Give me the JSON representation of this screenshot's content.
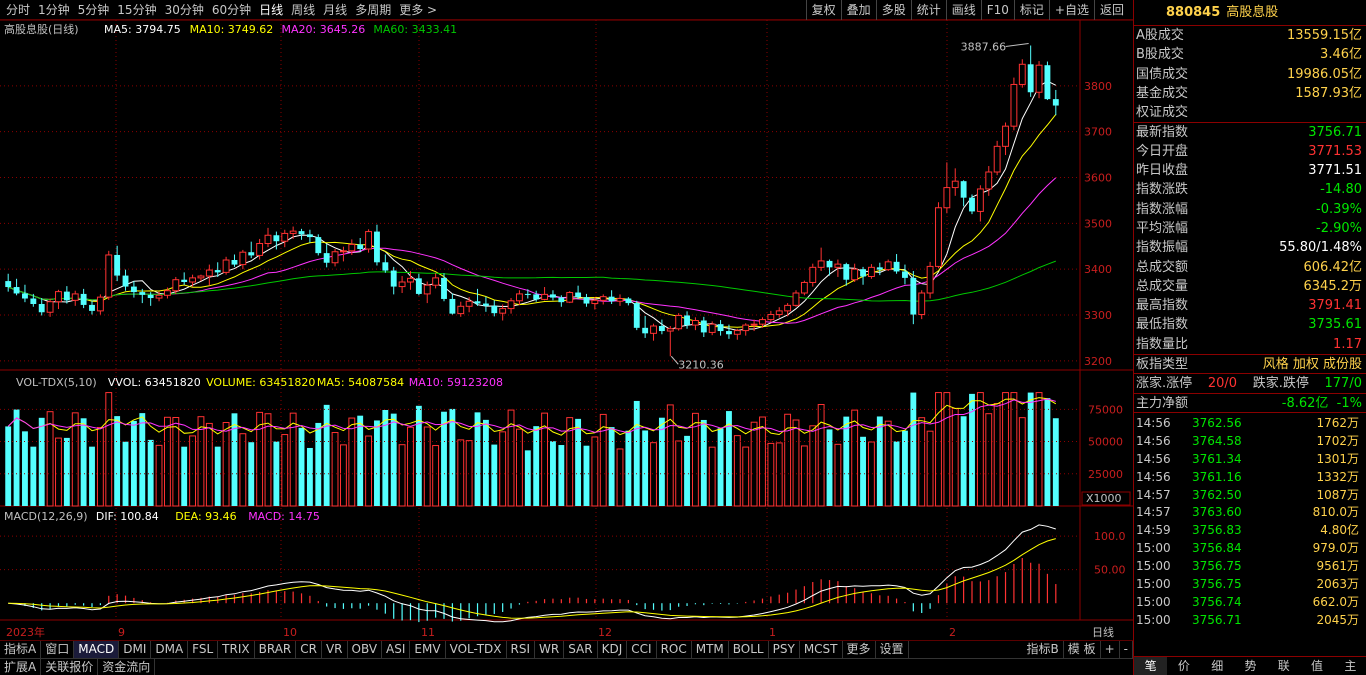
{
  "toolbar": {
    "periods": [
      "分时",
      "1分钟",
      "5分钟",
      "15分钟",
      "30分钟",
      "60分钟",
      "日线",
      "周线",
      "月线",
      "多周期",
      "更多 >"
    ],
    "active_period": "日线",
    "actions": [
      "复权",
      "叠加",
      "多股",
      "统计",
      "画线",
      "F10",
      "标记",
      "+自选",
      "返回"
    ]
  },
  "chart_data": {
    "type": "candlestick",
    "title": "高股息股(日线)",
    "ma_legend": [
      {
        "name": "MA5: 3794.75",
        "color": "#ffffff"
      },
      {
        "name": "MA10: 3749.62",
        "color": "#ffff00"
      },
      {
        "name": "MA20: 3645.26",
        "color": "#ff33ff"
      },
      {
        "name": "MA60: 3433.41",
        "color": "#00c800"
      }
    ],
    "price_axis": {
      "ticks": [
        3200,
        3300,
        3400,
        3500,
        3600,
        3700,
        3800
      ],
      "ylim": [
        3180,
        3900
      ]
    },
    "annotations": [
      {
        "text": "3887.66"
      },
      {
        "text": "3210.36"
      }
    ],
    "x_labels": [
      "2023年",
      "9",
      "10",
      "11",
      "12",
      "1",
      "2"
    ],
    "ohlc": [
      [
        3374,
        3390,
        3351,
        3361
      ],
      [
        3361,
        3379,
        3343,
        3347
      ],
      [
        3347,
        3366,
        3328,
        3336
      ],
      [
        3336,
        3346,
        3318,
        3324
      ],
      [
        3324,
        3337,
        3299,
        3306
      ],
      [
        3306,
        3336,
        3296,
        3329
      ],
      [
        3329,
        3355,
        3313,
        3351
      ],
      [
        3351,
        3363,
        3325,
        3332
      ],
      [
        3332,
        3353,
        3320,
        3346
      ],
      [
        3346,
        3357,
        3315,
        3322
      ],
      [
        3322,
        3331,
        3301,
        3309
      ],
      [
        3309,
        3345,
        3301,
        3339
      ],
      [
        3339,
        3440,
        3333,
        3431
      ],
      [
        3431,
        3451,
        3374,
        3386
      ],
      [
        3386,
        3399,
        3353,
        3362
      ],
      [
        3362,
        3374,
        3338,
        3350
      ],
      [
        3350,
        3357,
        3326,
        3344
      ],
      [
        3344,
        3350,
        3320,
        3337
      ],
      [
        3337,
        3351,
        3330,
        3343
      ],
      [
        3343,
        3360,
        3336,
        3353
      ],
      [
        3353,
        3383,
        3346,
        3377
      ],
      [
        3377,
        3393,
        3366,
        3372
      ],
      [
        3372,
        3388,
        3362,
        3381
      ],
      [
        3381,
        3388,
        3374,
        3385
      ],
      [
        3385,
        3410,
        3364,
        3398
      ],
      [
        3398,
        3415,
        3383,
        3393
      ],
      [
        3393,
        3427,
        3388,
        3420
      ],
      [
        3420,
        3432,
        3405,
        3410
      ],
      [
        3410,
        3442,
        3400,
        3437
      ],
      [
        3437,
        3460,
        3424,
        3430
      ],
      [
        3430,
        3466,
        3421,
        3456
      ],
      [
        3456,
        3490,
        3448,
        3474
      ],
      [
        3474,
        3482,
        3443,
        3461
      ],
      [
        3461,
        3486,
        3448,
        3478
      ],
      [
        3478,
        3493,
        3466,
        3483
      ],
      [
        3483,
        3488,
        3464,
        3476
      ],
      [
        3476,
        3486,
        3458,
        3470
      ],
      [
        3470,
        3476,
        3430,
        3435
      ],
      [
        3435,
        3455,
        3404,
        3414
      ],
      [
        3414,
        3444,
        3406,
        3438
      ],
      [
        3438,
        3449,
        3417,
        3440
      ],
      [
        3440,
        3465,
        3431,
        3454
      ],
      [
        3454,
        3468,
        3438,
        3444
      ],
      [
        3444,
        3487,
        3436,
        3482
      ],
      [
        3482,
        3497,
        3408,
        3415
      ],
      [
        3415,
        3432,
        3392,
        3397
      ],
      [
        3397,
        3405,
        3345,
        3362
      ],
      [
        3362,
        3385,
        3348,
        3372
      ],
      [
        3372,
        3396,
        3355,
        3380
      ],
      [
        3380,
        3390,
        3343,
        3346
      ],
      [
        3346,
        3373,
        3326,
        3365
      ],
      [
        3365,
        3391,
        3358,
        3381
      ],
      [
        3381,
        3391,
        3330,
        3335
      ],
      [
        3335,
        3347,
        3301,
        3303
      ],
      [
        3303,
        3329,
        3296,
        3319
      ],
      [
        3319,
        3339,
        3306,
        3330
      ],
      [
        3330,
        3357,
        3320,
        3325
      ],
      [
        3325,
        3340,
        3307,
        3320
      ],
      [
        3320,
        3332,
        3297,
        3304
      ],
      [
        3304,
        3323,
        3288,
        3314
      ],
      [
        3314,
        3337,
        3303,
        3331
      ],
      [
        3331,
        3354,
        3322,
        3346
      ],
      [
        3346,
        3356,
        3336,
        3345
      ],
      [
        3345,
        3353,
        3329,
        3334
      ],
      [
        3334,
        3361,
        3332,
        3345
      ],
      [
        3345,
        3354,
        3332,
        3338
      ],
      [
        3338,
        3343,
        3318,
        3328
      ],
      [
        3328,
        3352,
        3326,
        3349
      ],
      [
        3349,
        3364,
        3335,
        3339
      ],
      [
        3339,
        3346,
        3318,
        3325
      ],
      [
        3325,
        3339,
        3312,
        3332
      ],
      [
        3332,
        3345,
        3323,
        3340
      ],
      [
        3340,
        3354,
        3324,
        3330
      ],
      [
        3330,
        3345,
        3320,
        3336
      ],
      [
        3336,
        3339,
        3321,
        3326
      ],
      [
        3326,
        3331,
        3267,
        3272
      ],
      [
        3272,
        3298,
        3250,
        3260
      ],
      [
        3260,
        3281,
        3244,
        3276
      ],
      [
        3276,
        3290,
        3258,
        3265
      ],
      [
        3265,
        3276,
        3210,
        3270
      ],
      [
        3270,
        3304,
        3266,
        3299
      ],
      [
        3299,
        3308,
        3270,
        3278
      ],
      [
        3278,
        3295,
        3267,
        3288
      ],
      [
        3288,
        3296,
        3252,
        3262
      ],
      [
        3262,
        3286,
        3256,
        3280
      ],
      [
        3280,
        3289,
        3255,
        3265
      ],
      [
        3265,
        3279,
        3248,
        3258
      ],
      [
        3258,
        3270,
        3246,
        3266
      ],
      [
        3266,
        3282,
        3255,
        3278
      ],
      [
        3278,
        3290,
        3265,
        3280
      ],
      [
        3280,
        3295,
        3272,
        3290
      ],
      [
        3290,
        3309,
        3284,
        3301
      ],
      [
        3301,
        3317,
        3294,
        3309
      ],
      [
        3309,
        3326,
        3297,
        3321
      ],
      [
        3321,
        3354,
        3318,
        3348
      ],
      [
        3348,
        3375,
        3343,
        3371
      ],
      [
        3371,
        3412,
        3362,
        3404
      ],
      [
        3404,
        3447,
        3396,
        3418
      ],
      [
        3418,
        3421,
        3386,
        3404
      ],
      [
        3404,
        3421,
        3383,
        3411
      ],
      [
        3411,
        3414,
        3364,
        3377
      ],
      [
        3377,
        3412,
        3372,
        3400
      ],
      [
        3400,
        3405,
        3366,
        3384
      ],
      [
        3384,
        3411,
        3379,
        3404
      ],
      [
        3404,
        3414,
        3387,
        3399
      ],
      [
        3399,
        3421,
        3396,
        3416
      ],
      [
        3416,
        3433,
        3390,
        3395
      ],
      [
        3395,
        3410,
        3367,
        3381
      ],
      [
        3381,
        3396,
        3280,
        3301
      ],
      [
        3301,
        3354,
        3291,
        3348
      ],
      [
        3348,
        3416,
        3336,
        3406
      ],
      [
        3406,
        3546,
        3402,
        3534
      ],
      [
        3534,
        3633,
        3522,
        3578
      ],
      [
        3578,
        3620,
        3560,
        3592
      ],
      [
        3592,
        3594,
        3537,
        3556
      ],
      [
        3556,
        3563,
        3520,
        3526
      ],
      [
        3526,
        3583,
        3504,
        3575
      ],
      [
        3575,
        3625,
        3560,
        3612
      ],
      [
        3612,
        3680,
        3605,
        3668
      ],
      [
        3668,
        3720,
        3649,
        3712
      ],
      [
        3712,
        3818,
        3703,
        3803
      ],
      [
        3803,
        3858,
        3796,
        3847
      ],
      [
        3847,
        3888,
        3776,
        3786
      ],
      [
        3786,
        3854,
        3773,
        3845
      ],
      [
        3845,
        3853,
        3769,
        3771
      ],
      [
        3771,
        3791,
        3736,
        3757
      ]
    ],
    "volume_legend": [
      {
        "name": "VOL-TDX(5,10)",
        "color": "#c0c0c0"
      },
      {
        "name": "VVOL: 63451820",
        "color": "#ffffff"
      },
      {
        "name": "VOLUME: 63451820",
        "color": "#ffff00"
      },
      {
        "name": "MA5: 54087584",
        "color": "#ffff00"
      },
      {
        "name": "MA10: 59123208",
        "color": "#ff33ff"
      }
    ],
    "volume_axis": {
      "ticks": [
        "75000",
        "50000",
        "25000"
      ],
      "unit": "X1000"
    },
    "macd_legend": [
      {
        "name": "MACD(12,26,9)",
        "color": "#c0c0c0"
      },
      {
        "name": "DIF: 100.84",
        "color": "#ffffff"
      },
      {
        "name": "DEA: 93.46",
        "color": "#ffff00"
      },
      {
        "name": "MACD: 14.75",
        "color": "#ff33ff"
      }
    ],
    "macd_axis": {
      "ticks": [
        "100.0",
        "50.00"
      ]
    },
    "period_label": "日线"
  },
  "indicator_tabs": [
    "指标A",
    "窗口",
    "MACD",
    "DMI",
    "DMA",
    "FSL",
    "TRIX",
    "BRAR",
    "CR",
    "VR",
    "OBV",
    "ASI",
    "EMV",
    "VOL-TDX",
    "RSI",
    "WR",
    "SAR",
    "KDJ",
    "CCI",
    "ROC",
    "MTM",
    "BOLL",
    "PSY",
    "MCST",
    "更多",
    "设置"
  ],
  "indicator_tabs_right": [
    "指标B",
    "模 板",
    "+",
    "-"
  ],
  "bottom_tabs": [
    "扩展A",
    "关联报价",
    "资金流向"
  ],
  "side": {
    "code": "880845",
    "name": "高股息股",
    "stats": [
      {
        "k": "A股成交",
        "v": "13559.15亿",
        "c": "yel"
      },
      {
        "k": "B股成交",
        "v": "3.46亿",
        "c": "yel"
      },
      {
        "k": "国债成交",
        "v": "19986.05亿",
        "c": "yel"
      },
      {
        "k": "基金成交",
        "v": "1587.93亿",
        "c": "yel"
      },
      {
        "k": "权证成交",
        "v": "",
        "c": "yel"
      },
      {
        "k": "最新指数",
        "v": "3756.71",
        "c": "green"
      },
      {
        "k": "今日开盘",
        "v": "3771.53",
        "c": "red"
      },
      {
        "k": "昨日收盘",
        "v": "3771.51",
        "c": ""
      },
      {
        "k": "指数涨跌",
        "v": "-14.80",
        "c": "green"
      },
      {
        "k": "指数涨幅",
        "v": "-0.39%",
        "c": "green"
      },
      {
        "k": "平均涨幅",
        "v": "-2.90%",
        "c": "green"
      },
      {
        "k": "指数振幅",
        "v": "55.80/1.48%",
        "c": ""
      },
      {
        "k": "总成交额",
        "v": "606.42亿",
        "c": "yel"
      },
      {
        "k": "总成交量",
        "v": "6345.2万",
        "c": "yel"
      },
      {
        "k": "最高指数",
        "v": "3791.41",
        "c": "red"
      },
      {
        "k": "最低指数",
        "v": "3735.61",
        "c": "green"
      },
      {
        "k": "指数量比",
        "v": "1.17",
        "c": "red"
      }
    ],
    "board_type_label": "板指类型",
    "board_type_value": "风格 加权 成份股",
    "updown": {
      "k1": "涨家.涨停",
      "v1": "20/0",
      "k2": "跌家.跌停",
      "v2": "177/0"
    },
    "net": {
      "k": "主力净额",
      "v": "-8.62亿",
      "pct": "-1%"
    },
    "ticks": [
      [
        "14:56",
        "3762.56",
        "1762万"
      ],
      [
        "14:56",
        "3764.58",
        "1702万"
      ],
      [
        "14:56",
        "3761.34",
        "1301万"
      ],
      [
        "14:56",
        "3761.16",
        "1332万"
      ],
      [
        "14:57",
        "3762.50",
        "1087万"
      ],
      [
        "14:57",
        "3763.60",
        "810.0万"
      ],
      [
        "14:59",
        "3756.83",
        "4.80亿"
      ],
      [
        "15:00",
        "3756.84",
        "979.0万"
      ],
      [
        "15:00",
        "3756.75",
        "9561万"
      ],
      [
        "15:00",
        "3756.75",
        "2063万"
      ],
      [
        "15:00",
        "3756.74",
        "662.0万"
      ],
      [
        "15:00",
        "3756.71",
        "2045万"
      ]
    ],
    "tabs": [
      "笔",
      "价",
      "细",
      "势",
      "联",
      "值",
      "主"
    ]
  }
}
